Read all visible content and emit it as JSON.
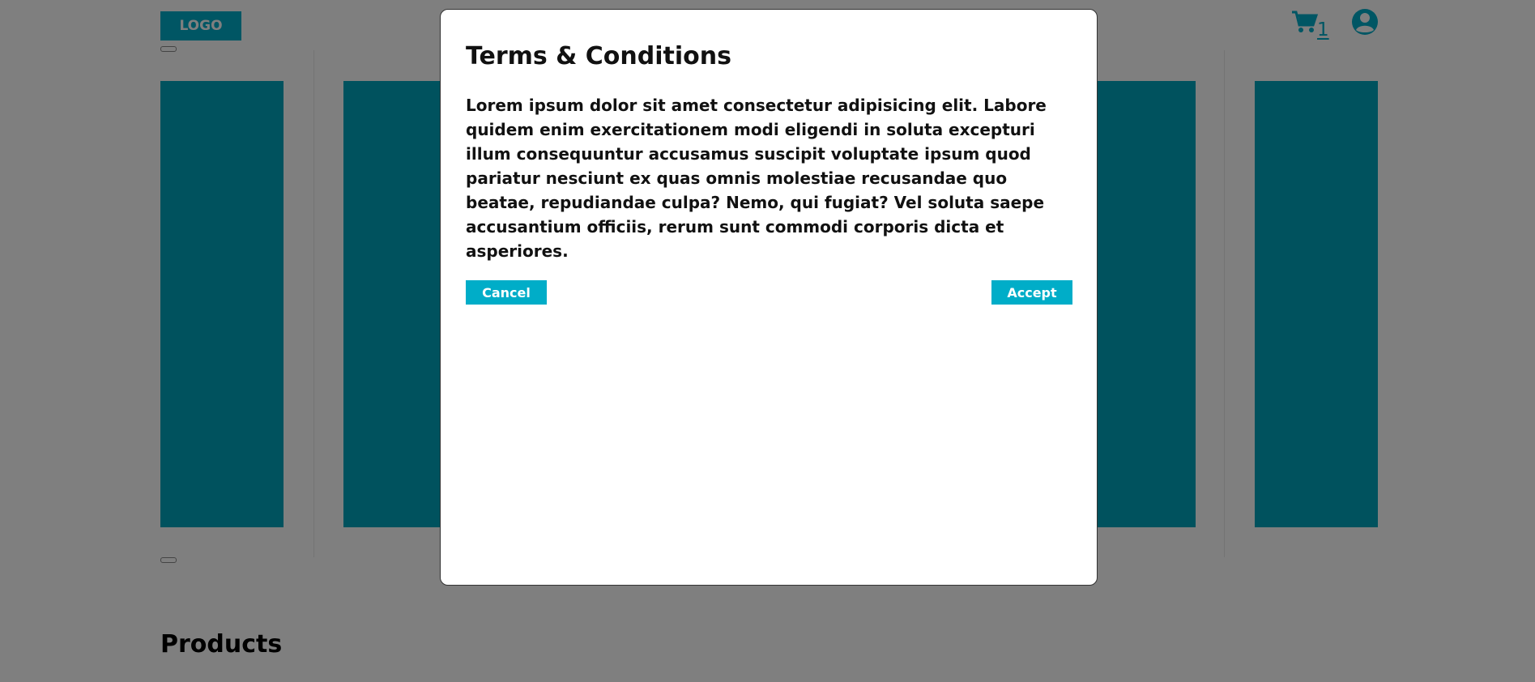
{
  "header": {
    "logo_label": "LOGO",
    "cart_count": "1",
    "cart_icon": "shopping-cart-icon",
    "account_icon": "user-circle-icon"
  },
  "carousel": {
    "slide_color": "#00a4bc"
  },
  "sections": {
    "products_heading": "Products"
  },
  "modal": {
    "title": "Terms & Conditions",
    "body": "Lorem ipsum dolor sit amet consectetur adipisicing elit. Labore quidem enim exercitationem modi eligendi in soluta excepturi illum consequuntur accusamus suscipit voluptate ipsum quod pariatur nesciunt ex quas omnis molestiae recusandae quo beatae, repudiandae culpa? Nemo, qui fugiat? Vel soluta saepe accusantium officiis, rerum sunt commodi corporis dicta et asperiores.",
    "cancel_label": "Cancel",
    "accept_label": "Accept"
  },
  "colors": {
    "accent": "#00adc8",
    "overlay": "rgba(0,0,0,0.5)"
  }
}
